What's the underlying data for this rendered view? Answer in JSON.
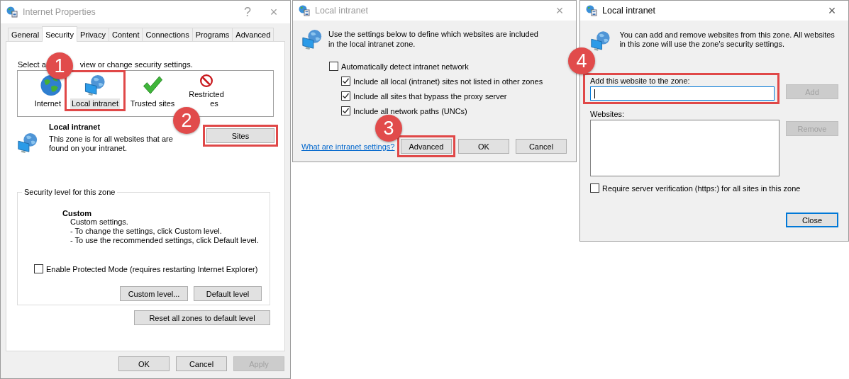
{
  "internet_properties": {
    "title": "Internet Properties",
    "active": false,
    "help": "?",
    "close": "×",
    "tabs": [
      {
        "label": "General",
        "selected": false
      },
      {
        "label": "Security",
        "selected": true
      },
      {
        "label": "Privacy",
        "selected": false
      },
      {
        "label": "Content",
        "selected": false
      },
      {
        "label": "Connections",
        "selected": false
      },
      {
        "label": "Programs",
        "selected": false
      },
      {
        "label": "Advanced",
        "selected": false
      }
    ],
    "zone_prompt": [
      "Select a",
      "view or change security settings."
    ],
    "zones": [
      {
        "kind": "globe",
        "lines": [
          "Internet"
        ],
        "selected": false,
        "highlighted": false
      },
      {
        "kind": "intranet",
        "lines": [
          "Local intranet"
        ],
        "selected": true,
        "highlighted": true
      },
      {
        "kind": "check",
        "lines": [
          "Trusted sites"
        ],
        "selected": false,
        "highlighted": false
      },
      {
        "kind": "restricted",
        "lines": [
          "Restricted",
          "es"
        ],
        "selected": false,
        "highlighted": false
      }
    ],
    "zone_name": "Local intranet",
    "zone_description": "This zone is for all websites that are found on your intranet.",
    "sites_button": {
      "label": "Sites",
      "highlighted": true
    },
    "security_level": {
      "title": "Security level for this zone",
      "name": "Custom",
      "lines": [
        "Custom settings.",
        "- To change the settings, click Custom level.",
        "- To use the recommended settings, click Default level."
      ],
      "protected_mode": {
        "label": "Enable Protected Mode (requires restarting Internet Explorer)",
        "checked": false
      },
      "buttons": [
        "Custom level...",
        "Default level"
      ]
    },
    "reset_button": "Reset all zones to default level",
    "footer_buttons": [
      {
        "label": "OK",
        "disabled": false
      },
      {
        "label": "Cancel",
        "disabled": false
      },
      {
        "label": "Apply",
        "disabled": true
      }
    ]
  },
  "intranet_dialog": {
    "title": "Local intranet",
    "active": false,
    "close": "×",
    "description": "Use the settings below to define which websites are included in the local intranet zone.",
    "options": [
      {
        "label": "Automatically detect intranet network",
        "checked": false,
        "children": [
          {
            "label": "Include all local (intranet) sites not listed in other zones",
            "checked": true
          },
          {
            "label": "Include all sites that bypass the proxy server",
            "checked": true
          },
          {
            "label": "Include all network paths (UNCs)",
            "checked": true
          }
        ]
      }
    ],
    "link": "What are intranet settings?",
    "buttons": [
      {
        "label": "Advanced",
        "highlighted": true
      },
      {
        "label": "OK",
        "highlighted": false
      },
      {
        "label": "Cancel",
        "highlighted": false
      }
    ]
  },
  "sites_dialog": {
    "title": "Local intranet",
    "active": true,
    "close": "×",
    "description": "You can add and remove websites from this zone. All websites in this zone will use the zone's security settings.",
    "add_field": {
      "label": "Add this website to the zone:",
      "focused": true,
      "highlighted": true
    },
    "add_button": {
      "label": "Add",
      "disabled": true
    },
    "websites_label": "Websites:",
    "remove_button": {
      "label": "Remove",
      "disabled": true
    },
    "https_option": {
      "label": "Require server verification (https:) for all sites in this zone",
      "checked": false
    },
    "close_button": {
      "label": "Close",
      "default": true
    }
  },
  "callouts": [
    "1",
    "2",
    "3",
    "4"
  ]
}
